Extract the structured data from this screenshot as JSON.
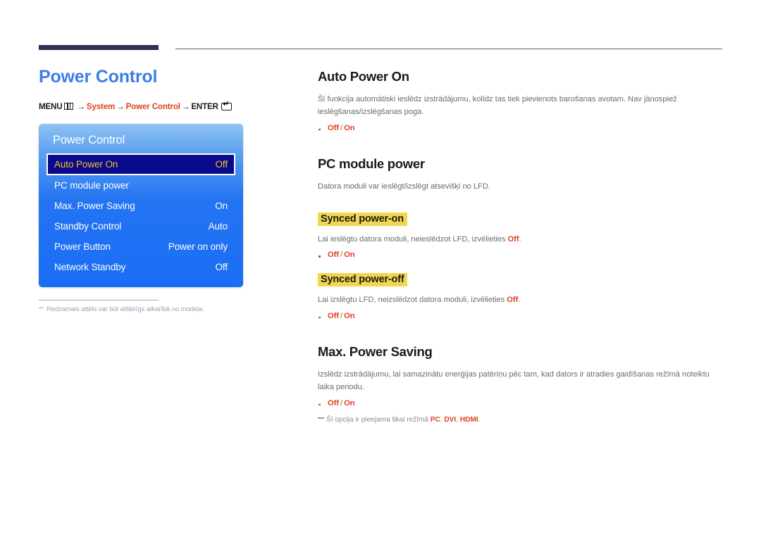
{
  "header": {
    "rule_accent_color": "#2e3052",
    "rule_line_color": "#5a5b75"
  },
  "left": {
    "page_title": "Power Control",
    "breadcrumb": {
      "menu_label": "MENU",
      "menu_icon": "menu-grid-icon",
      "arrow": "→",
      "item1": "System",
      "item2": "Power Control",
      "enter_label": "ENTER",
      "enter_icon": "enter-key-icon"
    },
    "osd": {
      "title": "Power Control",
      "rows": [
        {
          "label": "Auto Power On",
          "value": "Off",
          "selected": true
        },
        {
          "label": "PC module power",
          "value": "",
          "selected": false
        },
        {
          "label": "Max. Power Saving",
          "value": "On",
          "selected": false
        },
        {
          "label": "Standby Control",
          "value": "Auto",
          "selected": false
        },
        {
          "label": "Power Button",
          "value": "Power on only",
          "selected": false
        },
        {
          "label": "Network Standby",
          "value": "Off",
          "selected": false
        }
      ],
      "selected_bg": "#0a0a8c",
      "selected_text": "#f2c324",
      "panel_blue": "#1a6ef5"
    },
    "note": "Redzamais attēls var būt atšķirīgs atkarībā no modeļa."
  },
  "right": {
    "sections": [
      {
        "title": "Auto Power On",
        "paragraph": "Šī funkcija automātiski ieslēdz izstrādājumu, kolīdz tas tiek pievienots barošanas avotam. Nav jānospiež ieslēgšanas/izslēgšanas poga.",
        "option_off": "Off",
        "option_sep": "/",
        "option_on": "On"
      },
      {
        "title": "PC module power",
        "paragraph": "Datora moduli var ieslēgt/izslēgt atsevišķi no LFD.",
        "sub1_head": "Synced power-on",
        "sub1_pre": "Lai ieslēgtu datora moduli, neieslēdzot LFD, izvēlieties ",
        "sub1_strong": "Off",
        "sub1_post": ".",
        "sub1_option_off": "Off",
        "sub1_option_sep": "/",
        "sub1_option_on": "On",
        "sub2_head": "Synced power-off",
        "sub2_pre": "Lai izslēgtu LFD, neizslēdzot datora moduli, izvēlieties ",
        "sub2_strong": "Off",
        "sub2_post": ".",
        "sub2_option_off": "Off",
        "sub2_option_sep": "/",
        "sub2_option_on": "On"
      },
      {
        "title": "Max. Power Saving",
        "paragraph": "Izslēdz izstrādājumu, lai samazinātu enerģijas patēriņu pēc tam, kad dators ir atradies gaidīšanas režīmā noteiktu laika periodu.",
        "option_off": "Off",
        "option_sep": "/",
        "option_on": "On",
        "footnote_pre": "Šī opcija ir pieejama tikai režīmā ",
        "footnote_mode1": "PC",
        "footnote_c1": ", ",
        "footnote_mode2": "DVI",
        "footnote_c2": ", ",
        "footnote_mode3": "HDMI",
        "footnote_end": "."
      }
    ]
  },
  "colors": {
    "title_blue": "#3b7ee8",
    "accent_red": "#e0401d",
    "highlight_yellow": "#f1d750",
    "body_gray": "#6c6c6e"
  }
}
